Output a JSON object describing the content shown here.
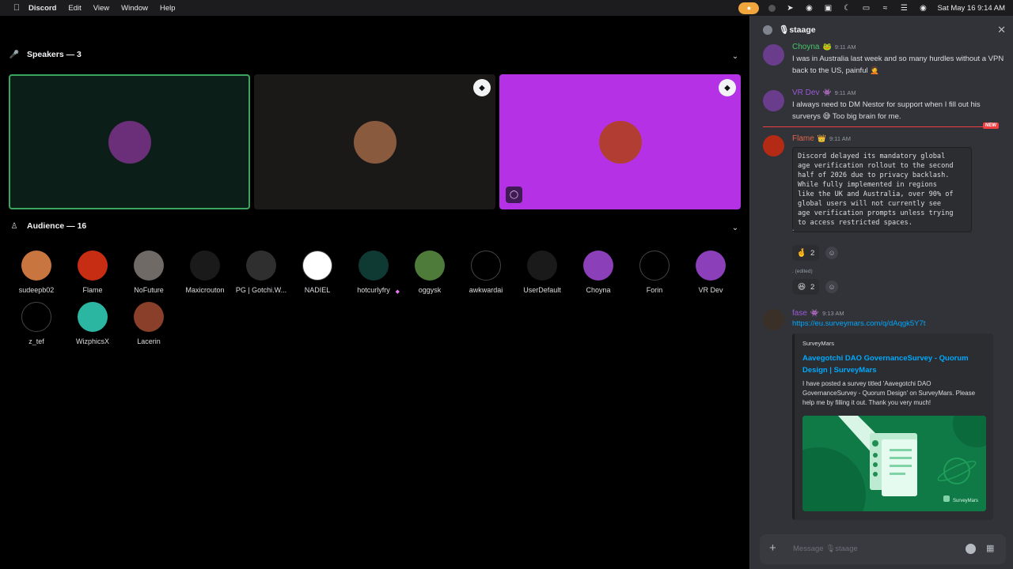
{
  "menubar": {
    "apple": "",
    "app_name": "Discord",
    "menus": [
      "Edit",
      "View",
      "Window",
      "Help"
    ],
    "clock": "Sat May 16  9:14 AM",
    "status_icons": [
      "mic-icon",
      "record-icon",
      "telegram-icon",
      "vpn-icon",
      "lock-icon",
      "moon-icon",
      "battery-icon",
      "wifi-icon",
      "control-center-icon",
      "siri-icon"
    ]
  },
  "stage": {
    "speakers_label": "Speakers — 3",
    "audience_label": "Audience — 16",
    "speakers": [
      {
        "name": "pirate-avatar",
        "bg": "#0b1e17",
        "border": "#3ba55d",
        "av": "#6b2f7a"
      },
      {
        "name": "beanie-avatar",
        "bg": "#1a1918",
        "av": "#8a5a3e"
      },
      {
        "name": "gamer-avatar",
        "bg": "#b431e6",
        "av": "#b23e33"
      }
    ],
    "audience": [
      {
        "name": "sudeepb02",
        "av": "#c9753f"
      },
      {
        "name": "Flame",
        "av": "#c62d12"
      },
      {
        "name": "NoFuture",
        "av": "#6f6a66"
      },
      {
        "name": "Maxicrouton",
        "av": "#1a1a1a"
      },
      {
        "name": "PG | Gotchi.W...",
        "av": "#2f2f2f"
      },
      {
        "name": "NADIEL",
        "av": "#ffffff"
      },
      {
        "name": "hotcurlyfry",
        "av": "#0f3a33",
        "boost": "◆"
      },
      {
        "name": "oggysk",
        "av": "#4e7a3a"
      },
      {
        "name": "awkwardai",
        "av": "#000000"
      },
      {
        "name": "UserDefault",
        "av": "#1a1a1a"
      },
      {
        "name": "Choyna",
        "av": "#8b3fb8"
      },
      {
        "name": "Forin",
        "av": "#000000"
      },
      {
        "name": "VR Dev",
        "av": "#8b3fb8"
      },
      {
        "name": "z_tef",
        "av": "#000000"
      },
      {
        "name": "WizphicsX",
        "av": "#2ab6a0"
      },
      {
        "name": "Lacerin",
        "av": "#8a3f2a"
      }
    ]
  },
  "chat": {
    "title": "🎙staage",
    "messages": [
      {
        "author": "Choyna",
        "author_color": "#46c46a",
        "tag": "🐸",
        "time": "9:11 AM",
        "text": "I was in Australia last week and so many hurdles without a VPN back to the US, painful 🤦"
      },
      {
        "author": "VR Dev",
        "author_color": "#9b59d6",
        "tag": "👾",
        "time": "9:11 AM",
        "text": "I always need to DM Nestor for support when I fill out his surverys 😅  Too big brain for me."
      },
      {
        "author": "Flame",
        "author_color": "#e0654f",
        "tag": "👑",
        "time": "9:11 AM",
        "code": "Discord delayed its mandatory global\nage verification rollout to the second\nhalf of 2026 due to privacy backlash.\nWhile fully implemented in regions\nlike the UK and Australia, over 90% of\nglobal users will not currently see\nage verification prompts unless trying\nto access restricted spaces.",
        "code_tail": "`",
        "reactions": [
          {
            "emoji": "🤞",
            "count": "2"
          },
          {
            "emoji": "😆",
            "count": "2"
          }
        ],
        "edited": ". (edited)"
      },
      {
        "author": "fase",
        "author_color": "#9b59d6",
        "tag": "👾",
        "time": "9:13 AM",
        "link": "https://eu.surveymars.com/q/dAqgk5Y7t",
        "embed": {
          "provider": "SurveyMars",
          "title": "Aavegotchi DAO GovernanceSurvey - Quorum Design | SurveyMars",
          "description": "I have posted a survey titled 'Aavegotchi DAO GovernanceSurvey - Quorum Design' on SurveyMars. Please help me by filling it out. Thank you very much!",
          "image_brand": "SurveyMars"
        }
      }
    ],
    "new_label": "NEW",
    "composer_placeholder": "Message 🎙staage"
  }
}
